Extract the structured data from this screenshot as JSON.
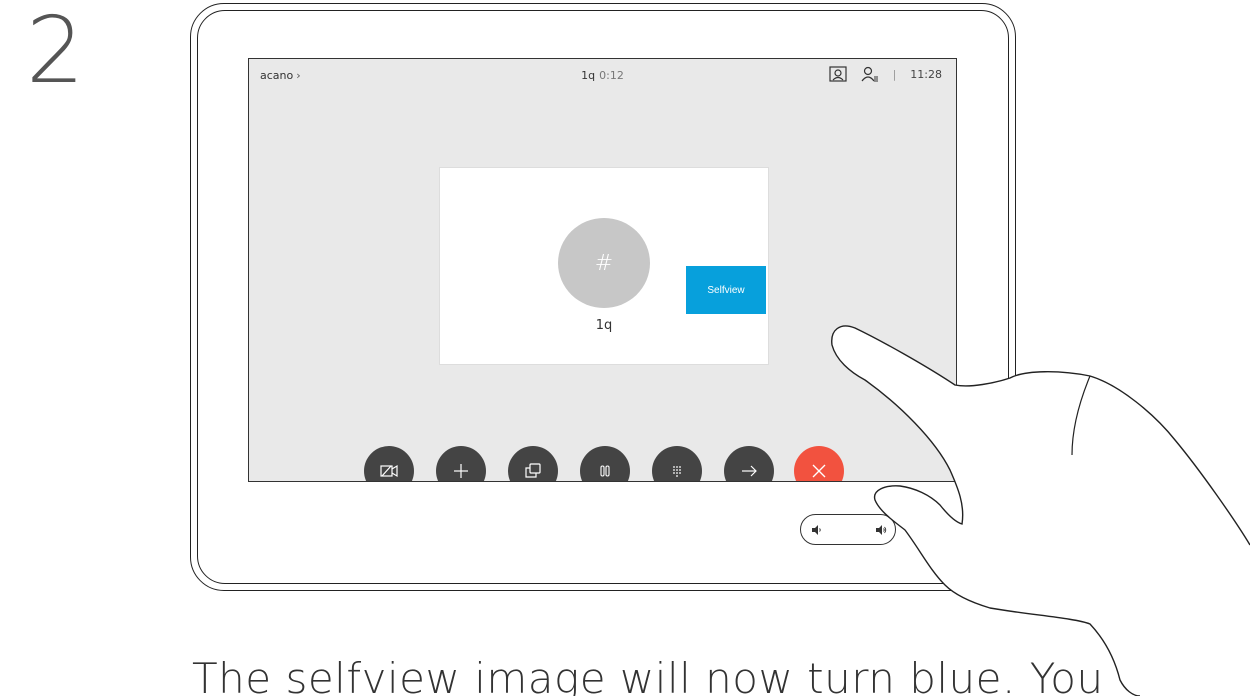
{
  "step_number": "2",
  "topbar": {
    "meeting_name": "acano",
    "call_name": "1q",
    "call_duration": "0:12",
    "time": "11:28",
    "icons": [
      "selfview-camera-icon",
      "participants-icon"
    ]
  },
  "card": {
    "avatar_text": "#",
    "name": "1q"
  },
  "selfview_button": "Selfview",
  "controls": [
    {
      "name": "camera-off",
      "icon": "camera-off-icon"
    },
    {
      "name": "add",
      "icon": "plus-icon"
    },
    {
      "name": "share",
      "icon": "share-icon"
    },
    {
      "name": "hold",
      "icon": "pause-icon"
    },
    {
      "name": "keypad",
      "icon": "keypad-icon"
    },
    {
      "name": "transfer",
      "icon": "arrow-right-icon"
    },
    {
      "name": "end-call",
      "icon": "close-icon"
    }
  ],
  "colors": {
    "selfview": "#07a0dc",
    "end_call": "#f2523f",
    "control": "#444444",
    "screen_bg": "#e9e9e9"
  },
  "caption": "The selfview image will now turn blue. You"
}
